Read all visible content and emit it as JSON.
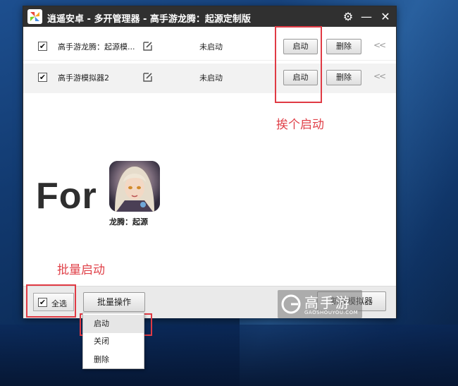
{
  "window": {
    "title": "逍遥安卓 - 多开管理器 - 高手游龙腾：起源定制版"
  },
  "rows": [
    {
      "checked": "✔",
      "name": "高手游龙腾：起源模...",
      "status": "未启动",
      "start_label": "启动",
      "delete_label": "删除",
      "collapse": "<<"
    },
    {
      "checked": "✔",
      "name": "高手游模拟器2",
      "status": "未启动",
      "start_label": "启动",
      "delete_label": "删除",
      "collapse": "<<"
    }
  ],
  "promo": {
    "for_text": "For",
    "game_name": "龙腾：起源"
  },
  "annotations": {
    "swap_start": "挨个启动",
    "batch_start": "批量启动"
  },
  "bottom_bar": {
    "select_all_check": "✔",
    "select_all_label": "全选",
    "batch_label": "批量操作",
    "new_emulator_label": "新建模拟器"
  },
  "batch_menu": {
    "items": [
      "启动",
      "关闭",
      "删除"
    ]
  },
  "watermark": {
    "text": "高手游",
    "sub": "GAOSHOUYOU.COM"
  },
  "colors": {
    "annotation_red": "#e0424a",
    "titlebar": "#303030"
  }
}
